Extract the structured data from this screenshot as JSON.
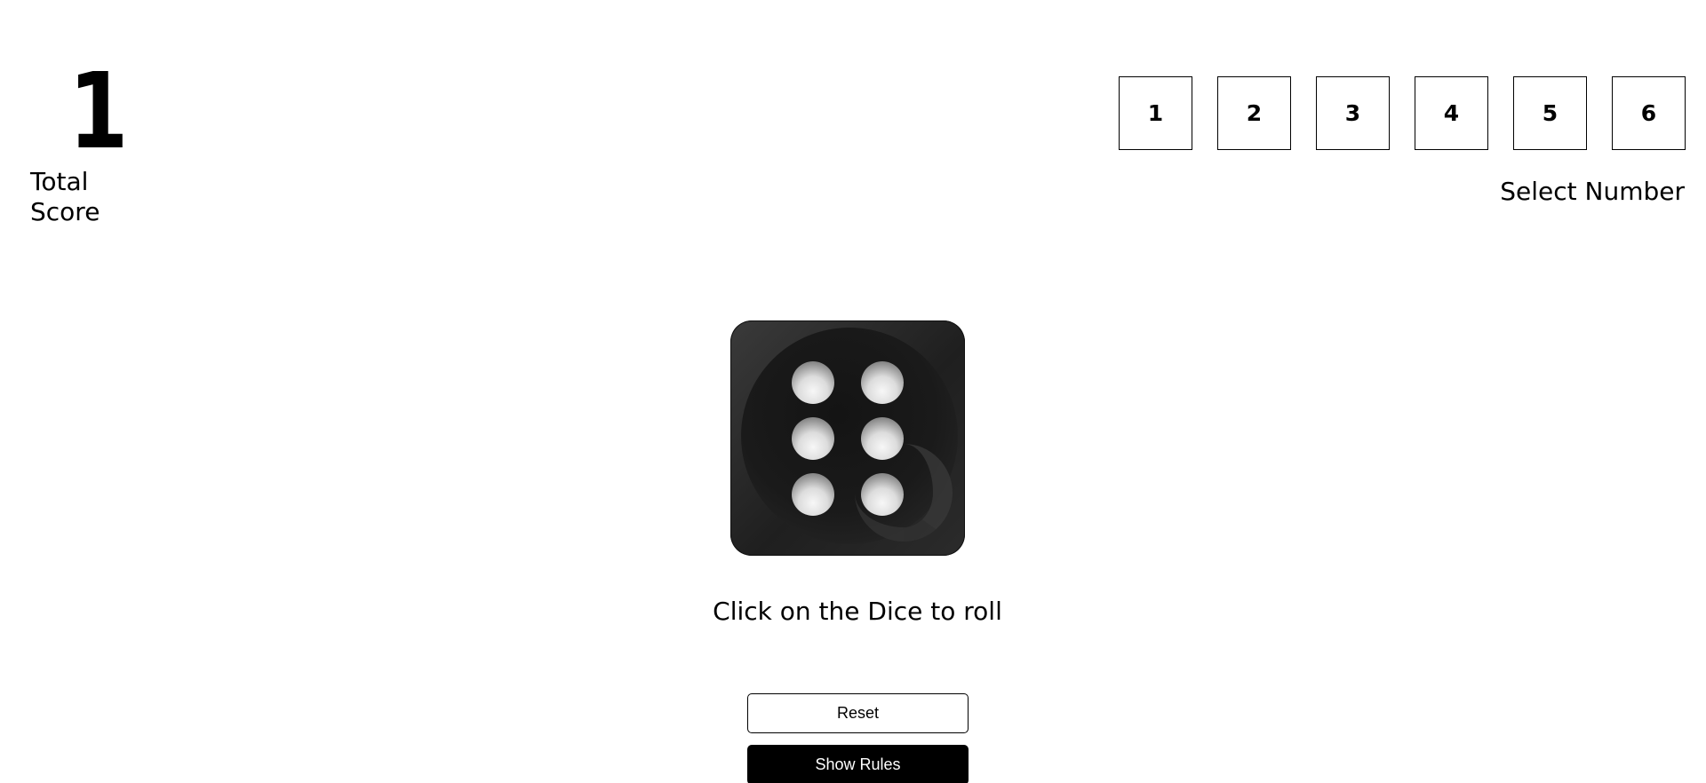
{
  "score": {
    "value": "1",
    "label": "Total Score"
  },
  "number_selector": {
    "options": [
      "1",
      "2",
      "3",
      "4",
      "5",
      "6"
    ],
    "label": "Select Number"
  },
  "dice": {
    "face_value": 6,
    "icon": "dice-six-icon",
    "hint": "Click on the Dice to roll"
  },
  "buttons": {
    "reset_label": "Reset",
    "rules_label": "Show Rules"
  },
  "colors": {
    "background": "#ffffff",
    "text": "#000000",
    "dice_body": "#222222",
    "pip": "#e6e6e6"
  }
}
